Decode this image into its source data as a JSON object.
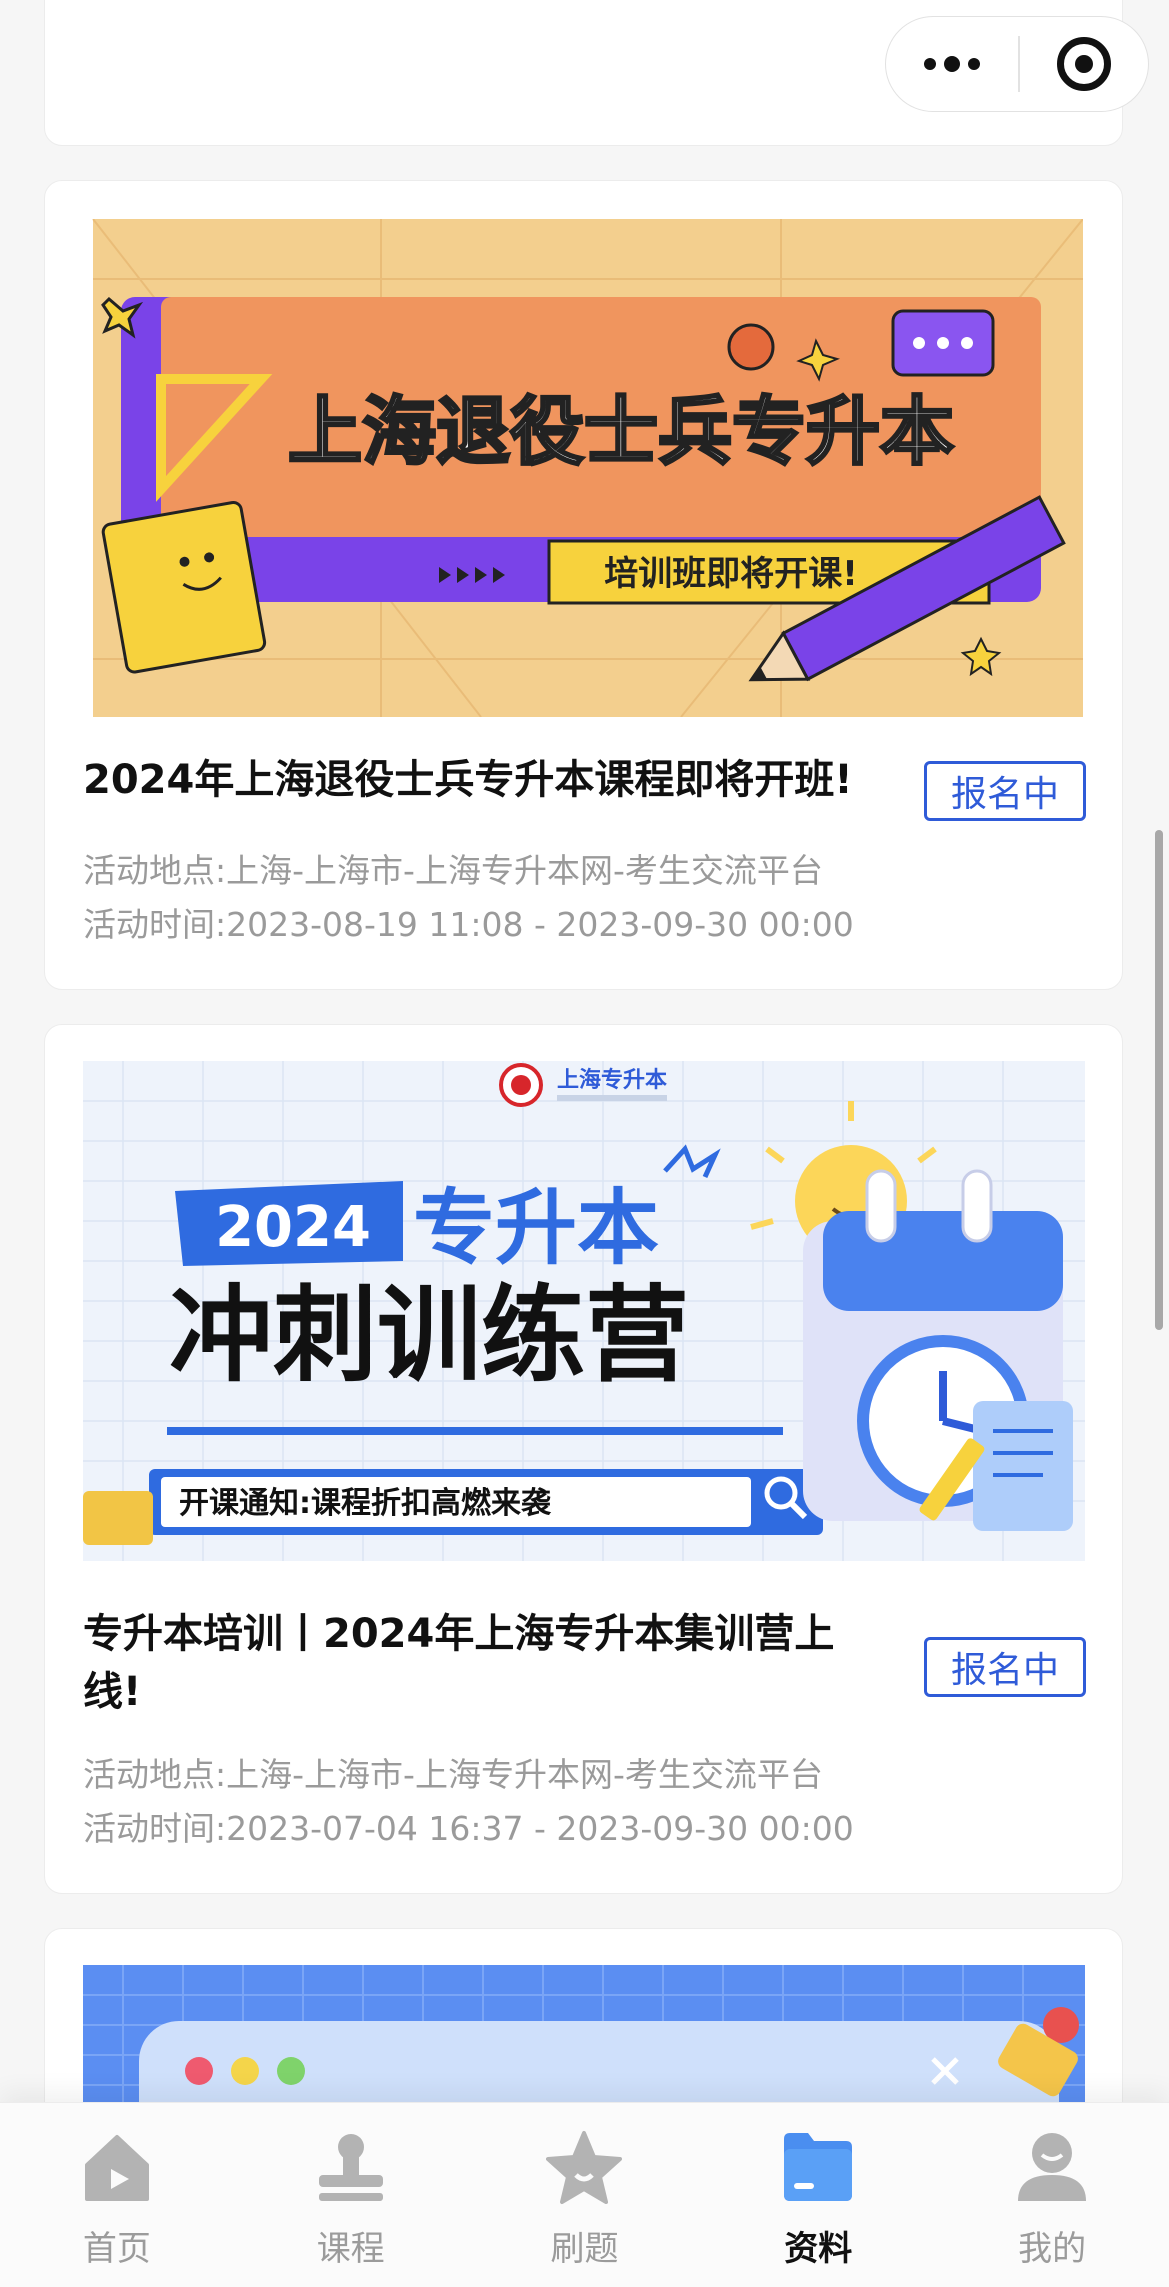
{
  "capsule": {
    "more_icon": "more-dots-icon",
    "close_icon": "target-circle-icon"
  },
  "cards": [
    {
      "banner": {
        "headline": "上海退役士兵专升本",
        "ribbon": "培训班即将开课!"
      },
      "title": "2024年上海退役士兵专升本课程即将开班!",
      "status": "报名中",
      "location_label": "活动地点:",
      "location": "上海-上海市-上海专升本网-考生交流平台",
      "time_label": "活动时间:",
      "time": "2023-08-19 11:08 - 2023-09-30 00:00"
    },
    {
      "banner": {
        "logo": "上海专升本",
        "year": "2024",
        "headline1": "专升本",
        "headline2": "冲刺训练营",
        "notice": "开课通知:课程折扣高燃来袭"
      },
      "title_line1": "专升本培训丨2024年上海专升本集训营上",
      "title_line2": "线!",
      "status": "报名中",
      "location_label": "活动地点:",
      "location": "上海-上海市-上海专升本网-考生交流平台",
      "time_label": "活动时间:",
      "time": "2023-07-04 16:37 - 2023-09-30 00:00"
    }
  ],
  "tabbar": {
    "tabs": [
      {
        "label": "首页",
        "icon": "home-icon",
        "active": false
      },
      {
        "label": "课程",
        "icon": "stamp-icon",
        "active": false
      },
      {
        "label": "刷题",
        "icon": "star-icon",
        "active": false
      },
      {
        "label": "资料",
        "icon": "folder-icon",
        "active": true
      },
      {
        "label": "我的",
        "icon": "user-icon",
        "active": false
      }
    ],
    "active_color": "#4a8ef0",
    "inactive_color": "#b3b3b3"
  }
}
